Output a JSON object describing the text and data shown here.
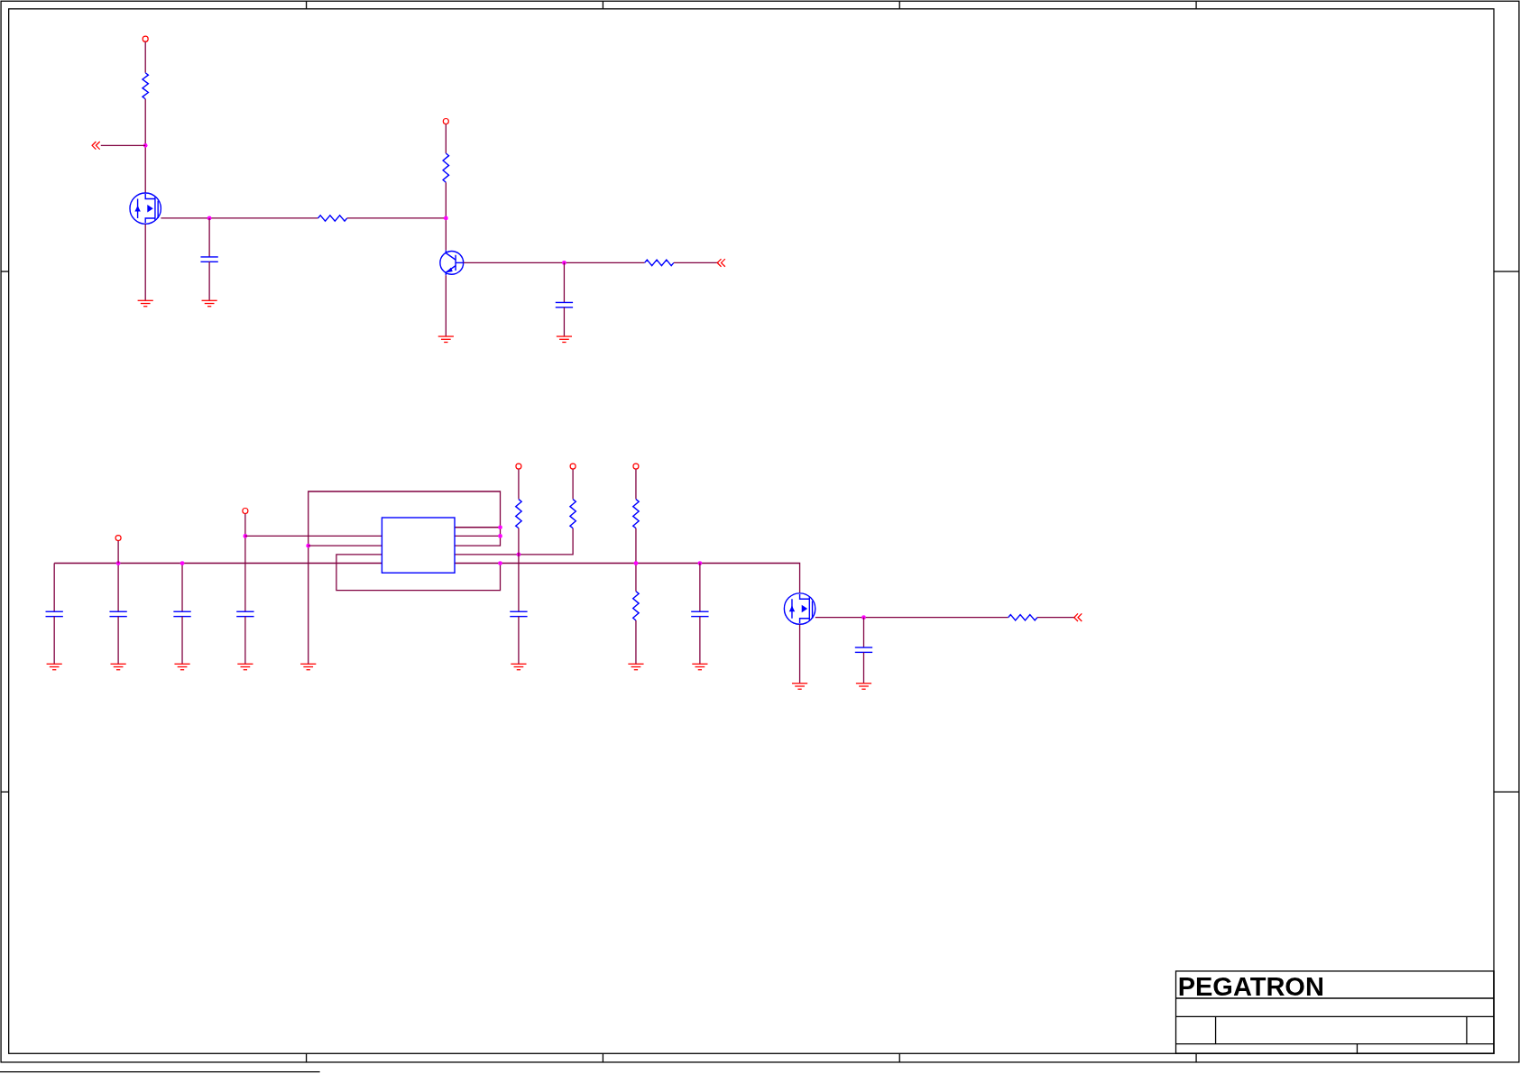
{
  "title_block": {
    "logo": "PEGATRON"
  }
}
